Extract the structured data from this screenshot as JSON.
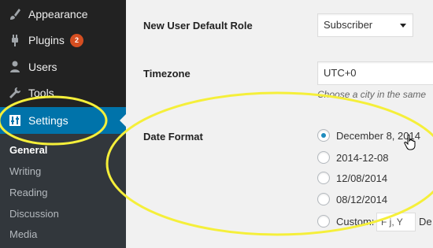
{
  "sidebar": {
    "menu": [
      {
        "label": "Appearance",
        "icon": "paintbrush-icon"
      },
      {
        "label": "Plugins",
        "icon": "plug-icon",
        "badge": "2"
      },
      {
        "label": "Users",
        "icon": "users-icon"
      },
      {
        "label": "Tools",
        "icon": "wrench-icon"
      },
      {
        "label": "Settings",
        "icon": "sliders-icon",
        "current": true
      }
    ],
    "submenu": [
      "General",
      "Writing",
      "Reading",
      "Discussion",
      "Media"
    ],
    "active_submenu": "General"
  },
  "settings": {
    "default_role_label": "New User Default Role",
    "default_role_value": "Subscriber",
    "timezone_label": "Timezone",
    "timezone_value": "UTC+0",
    "timezone_description": "Choose a city in the same",
    "date_format_label": "Date Format",
    "date_formats": [
      {
        "label": "December 8, 2014",
        "checked": true
      },
      {
        "label": "2014-12-08",
        "checked": false
      },
      {
        "label": "12/08/2014",
        "checked": false
      },
      {
        "label": "08/12/2014",
        "checked": false
      },
      {
        "label": "Custom:",
        "checked": false
      }
    ],
    "custom_format_value": "F j, Y",
    "custom_format_trailing": "De"
  },
  "colors": {
    "sidebar_bg": "#222222",
    "submenu_bg": "#32373c",
    "accent": "#0073aa",
    "badge": "#d54e21",
    "highlight": "#f5ef3a"
  }
}
